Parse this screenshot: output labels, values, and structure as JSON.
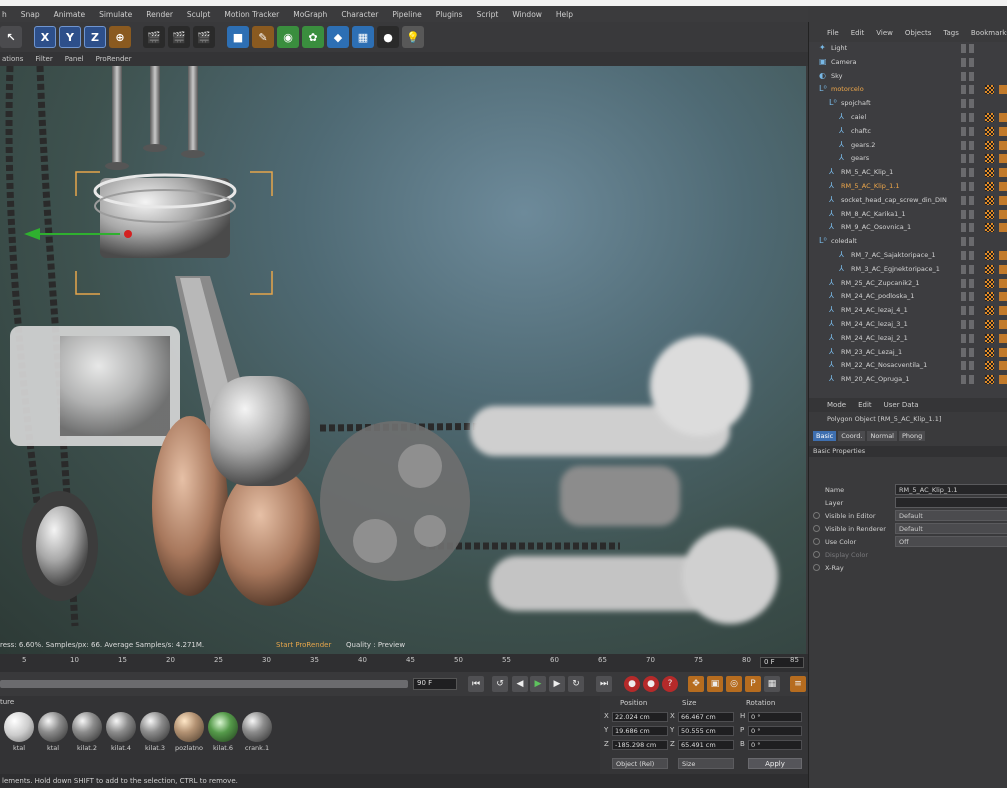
{
  "menubar": [
    "h",
    "Snap",
    "Animate",
    "Simulate",
    "Render",
    "Sculpt",
    "Motion Tracker",
    "MoGraph",
    "Character",
    "Pipeline",
    "Plugins",
    "Script",
    "Window",
    "Help"
  ],
  "toolbar": {
    "x": "X",
    "y": "Y",
    "z": "Z"
  },
  "viewport_menu": [
    "ations",
    "Filter",
    "Panel",
    "ProRender"
  ],
  "viewport_status": {
    "stats": "ress: 6.60%. Samples/px: 66. Average Samples/s: 4.271M.",
    "start_prorender": "Start ProRender",
    "quality": "Quality : Preview"
  },
  "timeline": {
    "ticks": [
      "5",
      "10",
      "15",
      "20",
      "25",
      "30",
      "35",
      "40",
      "45",
      "50",
      "55",
      "60",
      "65",
      "70",
      "75",
      "80",
      "85",
      "90"
    ],
    "current_frame": "0 F",
    "end_frame": "90 F"
  },
  "materials": {
    "label": "ture",
    "items": [
      {
        "name": "ktal",
        "style": "white"
      },
      {
        "name": "ktal",
        "style": "gray"
      },
      {
        "name": "kilat.2",
        "style": "gray"
      },
      {
        "name": "kilat.4",
        "style": "gray"
      },
      {
        "name": "kilat.3",
        "style": "gray"
      },
      {
        "name": "pozlatno",
        "style": "gold"
      },
      {
        "name": "kilat.6",
        "style": "green"
      },
      {
        "name": "crank.1",
        "style": "gray"
      }
    ]
  },
  "coords": {
    "headers": {
      "position": "Position",
      "size": "Size",
      "rotation": "Rotation"
    },
    "rows": [
      {
        "axis": "X",
        "pos": "22.024 cm",
        "size": "66.467 cm",
        "rlabel": "H",
        "rot": "0 °"
      },
      {
        "axis": "Y",
        "pos": "19.686 cm",
        "size": "50.555 cm",
        "rlabel": "P",
        "rot": "0 °"
      },
      {
        "axis": "Z",
        "pos": "-185.298 cm",
        "size": "65.491 cm",
        "rlabel": "B",
        "rot": "0 °"
      }
    ],
    "mode_object": "Object (Rel)",
    "mode_size": "Size",
    "apply": "Apply"
  },
  "statusbar": "lements. Hold down SHIFT to add to the selection, CTRL to remove.",
  "object_manager": {
    "menu": [
      "File",
      "Edit",
      "View",
      "Objects",
      "Tags",
      "Bookmarks"
    ],
    "objects": [
      {
        "name": "Light",
        "indent": 0,
        "icon": "light-icon",
        "glyph": "✦",
        "selected": false
      },
      {
        "name": "Camera",
        "indent": 0,
        "icon": "camera-icon",
        "glyph": "▣",
        "selected": false
      },
      {
        "name": "Sky",
        "indent": 0,
        "icon": "sky-icon",
        "glyph": "◐",
        "selected": false
      },
      {
        "name": "motorcelo",
        "indent": 0,
        "icon": "null-icon",
        "glyph": "L⁰",
        "selected": true
      },
      {
        "name": "spojchaft",
        "indent": 1,
        "icon": "null-icon",
        "glyph": "L⁰",
        "selected": false
      },
      {
        "name": "caiel",
        "indent": 2,
        "icon": "polygon-icon",
        "glyph": "⅄",
        "selected": false
      },
      {
        "name": "chaftc",
        "indent": 2,
        "icon": "polygon-icon",
        "glyph": "⅄",
        "selected": false
      },
      {
        "name": "gears.2",
        "indent": 2,
        "icon": "polygon-icon",
        "glyph": "⅄",
        "selected": false
      },
      {
        "name": "gears",
        "indent": 2,
        "icon": "polygon-icon",
        "glyph": "⅄",
        "selected": false
      },
      {
        "name": "RM_5_AC_Klip_1",
        "indent": 1,
        "icon": "polygon-icon",
        "glyph": "⅄",
        "selected": false
      },
      {
        "name": "RM_5_AC_Klip_1.1",
        "indent": 1,
        "icon": "polygon-icon",
        "glyph": "⅄",
        "selected": true
      },
      {
        "name": "socket_head_cap_screw_din_DIN",
        "indent": 1,
        "icon": "polygon-icon",
        "glyph": "⅄",
        "selected": false
      },
      {
        "name": "RM_8_AC_Karika1_1",
        "indent": 1,
        "icon": "polygon-icon",
        "glyph": "⅄",
        "selected": false
      },
      {
        "name": "RM_9_AC_Osovnica_1",
        "indent": 1,
        "icon": "polygon-icon",
        "glyph": "⅄",
        "selected": false
      },
      {
        "name": "coledalt",
        "indent": 0,
        "icon": "null-icon",
        "glyph": "L⁰",
        "selected": false
      },
      {
        "name": "RM_7_AC_Sajaktoripace_1",
        "indent": 2,
        "icon": "polygon-icon",
        "glyph": "⅄",
        "selected": false
      },
      {
        "name": "RM_3_AC_Egjnektoripace_1",
        "indent": 2,
        "icon": "polygon-icon",
        "glyph": "⅄",
        "selected": false
      },
      {
        "name": "RM_25_AC_Zupcanik2_1",
        "indent": 1,
        "icon": "polygon-icon",
        "glyph": "⅄",
        "selected": false
      },
      {
        "name": "RM_24_AC_podloska_1",
        "indent": 1,
        "icon": "polygon-icon",
        "glyph": "⅄",
        "selected": false
      },
      {
        "name": "RM_24_AC_lezaj_4_1",
        "indent": 1,
        "icon": "polygon-icon",
        "glyph": "⅄",
        "selected": false
      },
      {
        "name": "RM_24_AC_lezaj_3_1",
        "indent": 1,
        "icon": "polygon-icon",
        "glyph": "⅄",
        "selected": false
      },
      {
        "name": "RM_24_AC_lezaj_2_1",
        "indent": 1,
        "icon": "polygon-icon",
        "glyph": "⅄",
        "selected": false
      },
      {
        "name": "RM_23_AC_Lezaj_1",
        "indent": 1,
        "icon": "polygon-icon",
        "glyph": "⅄",
        "selected": false
      },
      {
        "name": "RM_22_AC_Nosacventila_1",
        "indent": 1,
        "icon": "polygon-icon",
        "glyph": "⅄",
        "selected": false
      },
      {
        "name": "RM_20_AC_Opruga_1",
        "indent": 1,
        "icon": "polygon-icon",
        "glyph": "⅄",
        "selected": false
      }
    ]
  },
  "attributes": {
    "menu": [
      "Mode",
      "Edit",
      "User Data"
    ],
    "title": "Polygon Object [RM_5_AC_Klip_1.1]",
    "tabs": [
      {
        "label": "Basic",
        "active": true
      },
      {
        "label": "Coord.",
        "active": false
      },
      {
        "label": "Normal",
        "active": false
      },
      {
        "label": "Phong",
        "active": false
      }
    ],
    "section": "Basic Properties",
    "props": [
      {
        "label": "Name",
        "value": "RM_5_AC_Klip_1.1",
        "kind": "field",
        "radio": false,
        "dim": false
      },
      {
        "label": "Layer",
        "value": "",
        "kind": "field",
        "radio": false,
        "dim": false
      },
      {
        "label": "Visible in Editor",
        "value": "Default",
        "kind": "drop",
        "radio": true,
        "dim": false
      },
      {
        "label": "Visible in Renderer",
        "value": "Default",
        "kind": "drop",
        "radio": true,
        "dim": false
      },
      {
        "label": "Use Color",
        "value": "Off",
        "kind": "drop",
        "radio": true,
        "dim": false
      },
      {
        "label": "Display Color",
        "value": "",
        "kind": "none",
        "radio": true,
        "dim": true
      },
      {
        "label": "X-Ray",
        "value": "",
        "kind": "none",
        "radio": true,
        "dim": false
      }
    ]
  }
}
